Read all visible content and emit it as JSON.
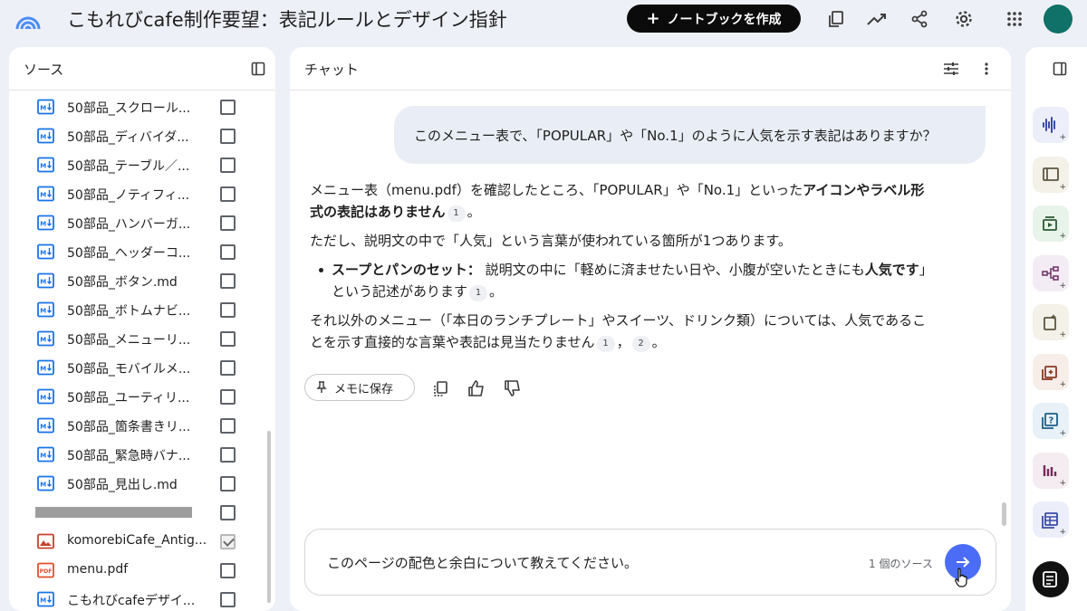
{
  "header": {
    "title": "こもれびcafe制作要望：表記ルールとデザイン指針",
    "create_label": "ノートブックを作成",
    "logo_icon": "notebook-logo-icon",
    "icons": [
      "copy-icon",
      "analytics-icon",
      "share-icon",
      "settings-icon",
      "apps-grid-icon",
      "avatar"
    ]
  },
  "sources": {
    "title": "ソース",
    "items": [
      {
        "label": "50部品_スクロール...",
        "icon": "markdown-doc-icon",
        "checked": false
      },
      {
        "label": "50部品_ディバイダ...",
        "icon": "markdown-doc-icon",
        "checked": false
      },
      {
        "label": "50部品_テーブル／...",
        "icon": "markdown-doc-icon",
        "checked": false
      },
      {
        "label": "50部品_ノティフィ...",
        "icon": "markdown-doc-icon",
        "checked": false
      },
      {
        "label": "50部品_ハンバーガ...",
        "icon": "markdown-doc-icon",
        "checked": false
      },
      {
        "label": "50部品_ヘッダーコ...",
        "icon": "markdown-doc-icon",
        "checked": false
      },
      {
        "label": "50部品_ボタン.md",
        "icon": "markdown-doc-icon",
        "checked": false
      },
      {
        "label": "50部品_ボトムナビ...",
        "icon": "markdown-doc-icon",
        "checked": false
      },
      {
        "label": "50部品_メニューリ...",
        "icon": "markdown-doc-icon",
        "checked": false
      },
      {
        "label": "50部品_モバイルメ...",
        "icon": "markdown-doc-icon",
        "checked": false
      },
      {
        "label": "50部品_ユーティリ...",
        "icon": "markdown-doc-icon",
        "checked": false
      },
      {
        "label": "50部品_箇条書きリ...",
        "icon": "markdown-doc-icon",
        "checked": false
      },
      {
        "label": "50部品_緊急時バナ...",
        "icon": "markdown-doc-icon",
        "checked": false
      },
      {
        "label": "50部品_見出し.md",
        "icon": "markdown-doc-icon",
        "checked": false
      },
      {
        "label": "",
        "icon": "redacted",
        "checked": false
      },
      {
        "label": "komorebiCafe_Antig...",
        "icon": "image-file-icon",
        "checked": true
      },
      {
        "label": "menu.pdf",
        "icon": "pdf-file-icon",
        "checked": false
      },
      {
        "label": "こもれびcafeデザイ...",
        "icon": "markdown-doc-icon",
        "checked": false
      }
    ]
  },
  "chat": {
    "title": "チャット",
    "user_message": "このメニュー表で、「POPULAR」や「No.1」のように人気を示す表記はありますか？",
    "answer": {
      "p1_a": "メニュー表（menu.pdf）を確認したところ、「POPULAR」や「No.1」といった",
      "p1_b": "アイコンやラベル形式の表記はありません",
      "p1_cite": "1",
      "p1_end": "。",
      "p2": "ただし、説明文の中で「人気」という言葉が使われている箇所が1つあります。",
      "bullet_bold": "スープとパンのセット：",
      "bullet_a": " 説明文の中に「軽めに済ませたい日や、小腹が空いたときにも",
      "bullet_bold2": "人気です",
      "bullet_b": "」という記述があります",
      "bullet_cite": "1",
      "bullet_end": "。",
      "p3": "それ以外のメニュー（「本日のランチプレート」やスイーツ、ドリンク類）については、人気であることを示す直接的な言葉や表記は見当たりません",
      "p3_cite1": "1",
      "p3_sep": "，",
      "p3_cite2": "2",
      "p3_end": "。"
    },
    "save_memo_label": "メモに保存",
    "input_value": "このページの配色と余白について教えてください。",
    "source_count": "1 個のソース"
  },
  "studio": {
    "buttons": [
      {
        "icon": "audio-overview-icon",
        "color": "#eceef9"
      },
      {
        "icon": "slides-icon",
        "color": "#f3f1e8"
      },
      {
        "icon": "video-overview-icon",
        "color": "#e8f3ea"
      },
      {
        "icon": "mind-map-icon",
        "color": "#f4ecf4"
      },
      {
        "icon": "reports-icon",
        "color": "#f3f1e8"
      },
      {
        "icon": "flashcards-icon",
        "color": "#f7ede9"
      },
      {
        "icon": "quiz-icon",
        "color": "#e7f1f7"
      },
      {
        "icon": "infographic-icon",
        "color": "#f4ecf1"
      },
      {
        "icon": "data-table-icon",
        "color": "#eceef9"
      }
    ]
  },
  "colors": {
    "accent_blue": "#4a6cf7",
    "doc_icon_blue": "#1a73e8",
    "pdf_red": "#e0502d",
    "image_orange": "#c5422c",
    "avatar": "#0f7168"
  }
}
